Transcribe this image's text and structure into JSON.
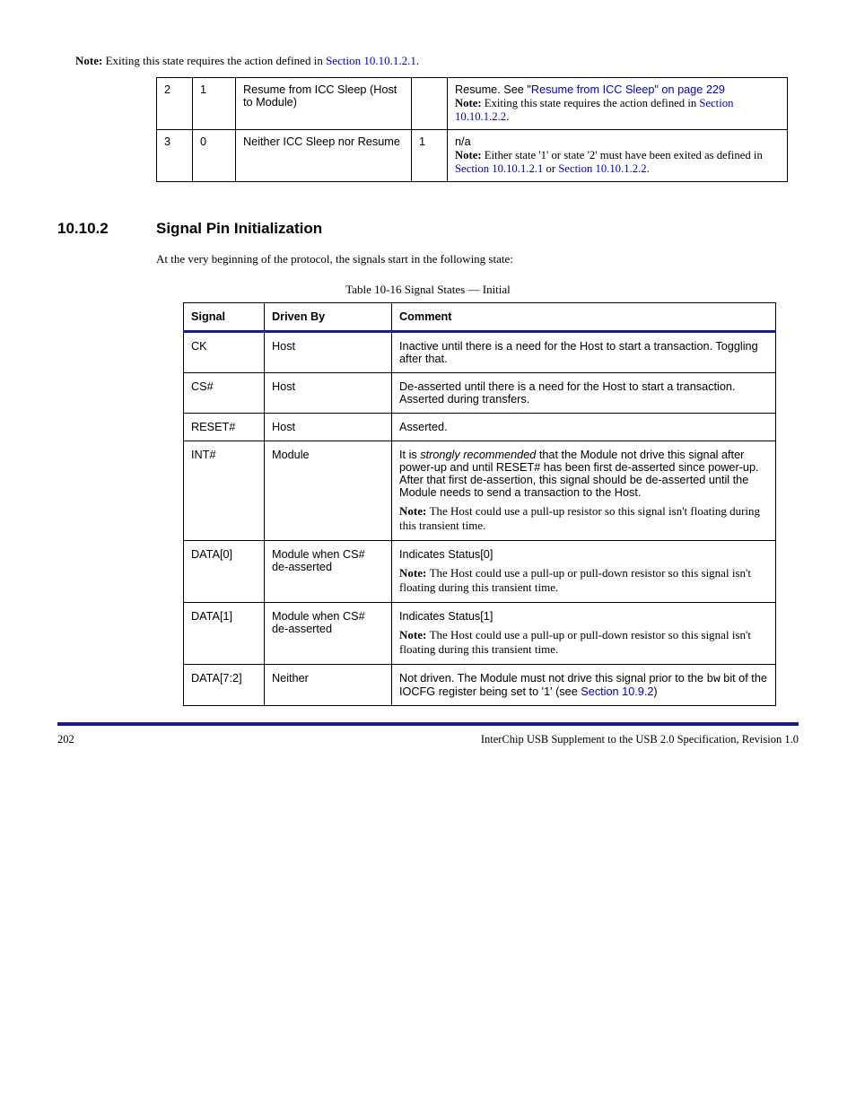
{
  "top_note_prefix": "Note: ",
  "top_note_body": "Exiting this state requires the action defined in ",
  "top_note_link": "Section 10.10.1.2.1",
  "top_note_tail": ".",
  "table1": {
    "cols": [
      "40",
      "48",
      "196",
      "40",
      "379"
    ],
    "rows": [
      {
        "c1": "2",
        "c2": "1",
        "c3": "Resume from ICC Sleep (Host to Module) ",
        "c4": "",
        "c5_pre": "Resume. See \"",
        "c5_link": "Resume from ICC Sleep\" on page 229",
        "c5_post": "",
        "note_label": "Note: ",
        "note_body": "Exiting this state requires the action defined in ",
        "note_link": "Section 10.10.1.2.2",
        "note_tail": "."
      },
      {
        "c1": "3",
        "c2": "0",
        "c3": "Neither ICC Sleep nor Resume",
        "c4": "1",
        "c5_plain": "n/a",
        "note_label": "Note: ",
        "note_body": "Either state '1' or state '2' must have been exited as defined in ",
        "note_link": "Section 10.10.1.2.1",
        "note_or": " or ",
        "note_link2": "Section 10.10.1.2.2",
        "note_tail2": "."
      }
    ]
  },
  "section_num": "10.10.2",
  "section_title": "Signal Pin Initialization",
  "section_intro": "At the very beginning of the protocol, the signals start in the following state:",
  "table2_caption": "Table 10-16  Signal States — Initial",
  "table2": {
    "headers": [
      "Signal",
      "Driven By",
      "Comment"
    ],
    "colw": [
      "90",
      "142",
      "428"
    ],
    "rows": [
      {
        "c1": "CK",
        "c2": "Host",
        "c3": "Inactive until there is a need for the Host to start a transaction. Toggling after that."
      },
      {
        "c1": "CS#",
        "c2": "Host",
        "c3": "De-asserted until there is a need for the Host to start a transaction. Asserted during transfers."
      },
      {
        "c1": "RESET#",
        "c2": "Host",
        "c3": "Asserted."
      },
      {
        "c1": "INT#",
        "c2": "Module",
        "c3_pre": "It is ",
        "c3_ital": "strongly recommended",
        "c3_post": " that the Module not drive this signal after power-up and until RESET# has been first de-asserted since power-up. After that first de-assertion, this signal should be de-asserted until the Module needs to send a transaction to the Host.",
        "note_label": "Note: ",
        "note_body": "The Host could use a pull-up resistor so this signal isn't floating during this transient time."
      },
      {
        "c1": "DATA[0]",
        "c2": "Module when CS# de-asserted",
        "c3_plain": "Indicates Status[0]",
        "note_label": "Note: ",
        "note_body": "The Host could use a pull-up or pull-down resistor so this signal isn't floating during this transient time."
      },
      {
        "c1": "DATA[1]",
        "c2": "Module when CS# de-asserted",
        "c3_plain": "Indicates Status[1]",
        "note_label": "Note: ",
        "note_body": "The Host could use a pull-up or pull-down resistor so this signal isn't floating during this transient time."
      },
      {
        "c1": "DATA[7:2]",
        "c2": "Neither",
        "c3_pre": "Not driven. The Module must not drive this signal prior to the ",
        "c3_mono": "bw",
        "c3_mid": " bit of the IOCFG register being set to '1' (see ",
        "c3_link": "Section 10.9.2",
        "c3_post": ")"
      }
    ]
  },
  "footer_left": "202",
  "footer_right": "InterChip USB Supplement to the USB 2.0 Specification, Revision 1.0"
}
